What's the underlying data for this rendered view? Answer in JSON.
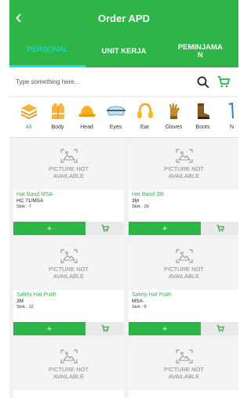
{
  "header": {
    "title": "Order APD",
    "back_icon": "chevron-left-icon"
  },
  "tabs": [
    {
      "label": "PERSONAL",
      "active": true
    },
    {
      "label": "UNIT KERJA",
      "active": false
    },
    {
      "label": "PEMINJAMA\nN",
      "active": false
    }
  ],
  "search": {
    "placeholder": "Type something here..."
  },
  "categories": [
    {
      "label": "All",
      "icon": "layers-icon"
    },
    {
      "label": "Body",
      "icon": "vest-icon"
    },
    {
      "label": "Head",
      "icon": "hard-hat-icon"
    },
    {
      "label": "Eyes",
      "icon": "goggles-icon"
    },
    {
      "label": "Ear",
      "icon": "earmuff-icon"
    },
    {
      "label": "Gloves",
      "icon": "glove-icon"
    },
    {
      "label": "Boots",
      "icon": "boot-icon"
    },
    {
      "label": "N",
      "icon": "more-icon"
    }
  ],
  "products": [
    {
      "image_text": "PICTURE NOT\nAVAILABLE",
      "name": "Hat Band MSA",
      "brand": "HC 71/MSA",
      "stock": "Stok : 7"
    },
    {
      "image_text": "PICTURE NOT\nAVAILABLE",
      "name": "Hat Band 3M",
      "brand": "3M",
      "stock": "Stok : 26"
    },
    {
      "image_text": "PICTURE NOT\nAVAILABLE",
      "name": "Safety Hat Putih",
      "brand": "3M",
      "stock": "Stok : 12"
    },
    {
      "image_text": "PICTURE NOT\nAVAILABLE",
      "name": "Safety Hat Putih",
      "brand": "MSA",
      "stock": "Stok : 9"
    },
    {
      "image_text": "PICTURE NOT\nAVAILABLE"
    },
    {
      "image_text": "PICTURE NOT\nAVAILABLE"
    }
  ],
  "actions": {
    "add_label": "+"
  },
  "colors": {
    "primary": "#2eb548",
    "tab_active": "#19e0f0"
  }
}
